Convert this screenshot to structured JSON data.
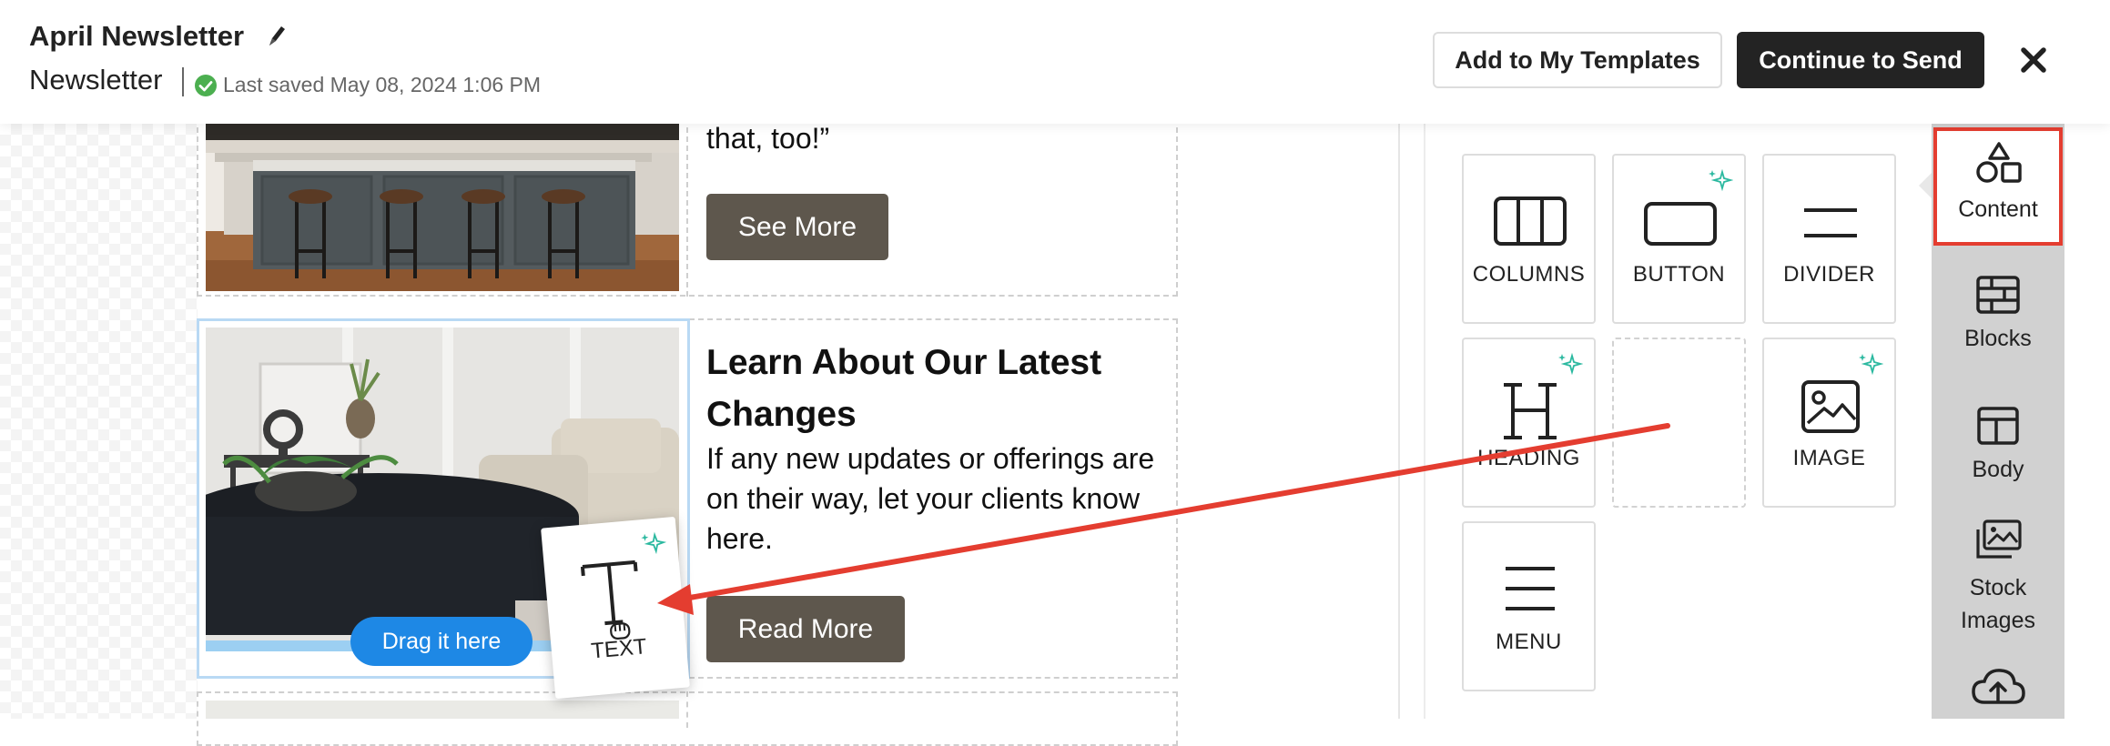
{
  "header": {
    "title": "April Newsletter",
    "doc_type": "Newsletter",
    "last_saved": "Last saved May 08, 2024 1:06 PM",
    "add_templates_label": "Add to My Templates",
    "continue_label": "Continue to Send"
  },
  "email": {
    "block1": {
      "quote_tail": "that, too!”",
      "button_label": "See More"
    },
    "block2": {
      "heading": "Learn About Our Latest Changes",
      "body": "If any new updates or offerings are on their way, let your clients know here.",
      "button_label": "Read More",
      "drop_hint": "Drag it here"
    },
    "dragged_tile_label": "TEXT"
  },
  "content_panel": {
    "tiles": [
      {
        "label": "COLUMNS",
        "icon": "columns-icon"
      },
      {
        "label": "BUTTON",
        "icon": "button-icon",
        "ai": true
      },
      {
        "label": "DIVIDER",
        "icon": "divider-icon"
      },
      {
        "label": "HEADING",
        "icon": "heading-icon",
        "ai": true
      },
      {
        "label": "",
        "icon": "empty-slot"
      },
      {
        "label": "IMAGE",
        "icon": "image-icon",
        "ai": true
      },
      {
        "label": "MENU",
        "icon": "menu-icon"
      }
    ]
  },
  "rail": {
    "items": [
      {
        "label": "Content",
        "icon": "shapes-icon",
        "active": true
      },
      {
        "label": "Blocks",
        "icon": "brick-icon"
      },
      {
        "label": "Body",
        "icon": "layout-icon"
      },
      {
        "label": "Stock Images",
        "icon": "stock-images-icon"
      },
      {
        "label": "",
        "icon": "cloud-upload-icon"
      }
    ]
  },
  "colors": {
    "accent_red": "#e43d30",
    "drop_blue": "#1e88e5",
    "sparkle_teal": "#2cb9a0",
    "email_button": "#5e574d"
  }
}
